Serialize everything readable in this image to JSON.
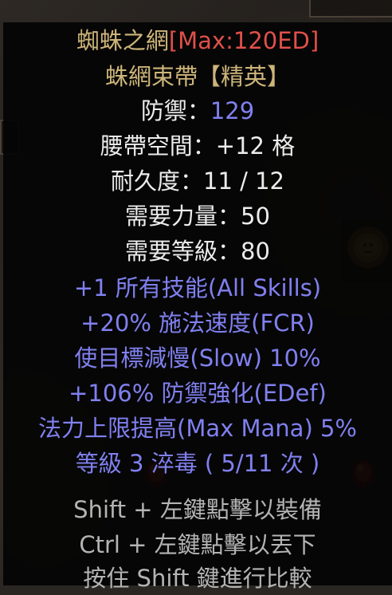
{
  "item": {
    "name": "蜘蛛之網",
    "max_tag": "[Max:120ED]",
    "base_type": "蛛網束帶【精英】"
  },
  "stats": [
    {
      "label": "防禦：",
      "value": "129"
    },
    {
      "label": "腰帶空間：",
      "value": "+12 格"
    },
    {
      "label": "耐久度：",
      "value": "11 / 12"
    },
    {
      "label": "需要力量：",
      "value": "50"
    },
    {
      "label": "需要等級：",
      "value": "80"
    }
  ],
  "mods": [
    "+1 所有技能(All Skills)",
    "+20% 施法速度(FCR)",
    "使目標減慢(Slow) 10%",
    "+106% 防禦強化(EDef)",
    "法力上限提高(Max Mana) 5%",
    "等級 3 淬毒 ( 5/11 次 )"
  ],
  "hints": [
    "Shift + 左鍵點擊以裝備",
    "Ctrl + 左鍵點擊以丟下",
    "按住 Shift 鍵進行比較"
  ],
  "colors": {
    "unique_gold": "#cdb57a",
    "max_red": "#e0504a",
    "stat_white": "#ececec",
    "mod_blue": "#8080f0",
    "hint_gray": "#b4b4b4"
  }
}
